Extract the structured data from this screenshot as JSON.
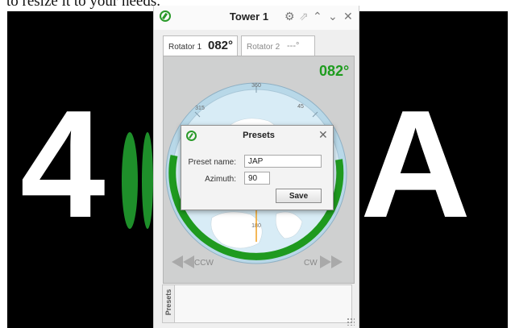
{
  "caption": {
    "text": "to resize it to your needs."
  },
  "background": {
    "big_text_left": "4",
    "big_text_right": "A"
  },
  "window": {
    "title": "Tower 1",
    "icons": [
      "gear-icon",
      "pin-icon",
      "chevron-up-icon",
      "chevron-down-icon",
      "close-icon"
    ],
    "accent_color": "#1e9c1e"
  },
  "tabs": [
    {
      "label": "Rotator 1",
      "value": "082°"
    },
    {
      "label": "Rotator 2",
      "value": "---°"
    }
  ],
  "rotator": {
    "heading": "082°",
    "compass_labels": [
      "360",
      "45",
      "315",
      "180"
    ],
    "ccw_label": "CCW",
    "cw_label": "CW",
    "current_azimuth_deg": 82
  },
  "presets_panel": {
    "label": "Presets"
  },
  "dialog": {
    "title": "Presets",
    "preset_name_label": "Preset name:",
    "preset_name_value": "JAP",
    "azimuth_label": "Azimuth:",
    "azimuth_value": "90",
    "save_label": "Save"
  }
}
